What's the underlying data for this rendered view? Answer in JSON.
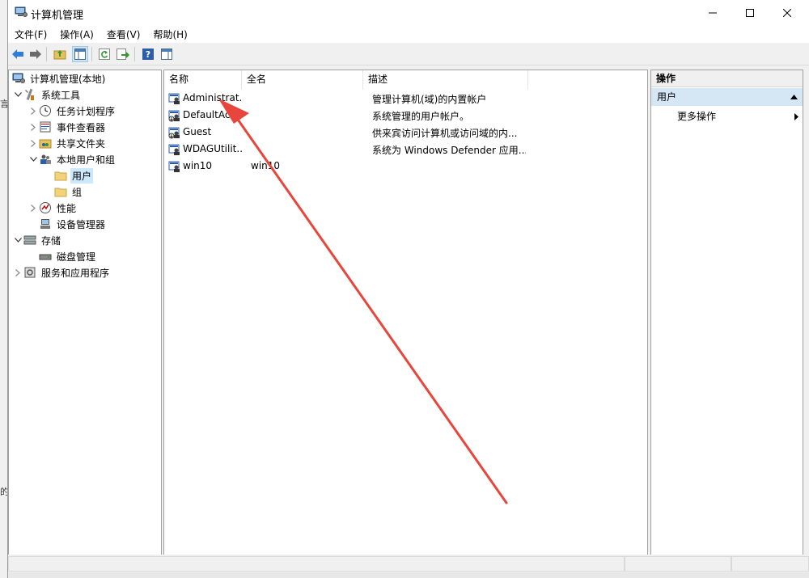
{
  "background_fragments": [
    "言",
    "的"
  ],
  "window": {
    "title": "计算机管理"
  },
  "menu": [
    {
      "label": "文件(F)"
    },
    {
      "label": "操作(A)"
    },
    {
      "label": "查看(V)"
    },
    {
      "label": "帮助(H)"
    }
  ],
  "tree": [
    {
      "label": "计算机管理(本地)",
      "icon": "computer-management-icon",
      "expander": "none"
    },
    {
      "label": "系统工具",
      "icon": "tools-icon",
      "expander": "expanded"
    },
    {
      "label": "任务计划程序",
      "icon": "clock-icon",
      "expander": "collapsed"
    },
    {
      "label": "事件查看器",
      "icon": "event-viewer-icon",
      "expander": "collapsed"
    },
    {
      "label": "共享文件夹",
      "icon": "shared-folder-icon",
      "expander": "collapsed"
    },
    {
      "label": "本地用户和组",
      "icon": "users-groups-icon",
      "expander": "expanded"
    },
    {
      "label": "用户",
      "icon": "folder-icon",
      "expander": "none",
      "selected": true
    },
    {
      "label": "组",
      "icon": "folder-icon",
      "expander": "none"
    },
    {
      "label": "性能",
      "icon": "performance-icon",
      "expander": "collapsed"
    },
    {
      "label": "设备管理器",
      "icon": "device-manager-icon",
      "expander": "none"
    },
    {
      "label": "存储",
      "icon": "storage-icon",
      "expander": "expanded"
    },
    {
      "label": "磁盘管理",
      "icon": "disk-icon",
      "expander": "none"
    },
    {
      "label": "服务和应用程序",
      "icon": "services-icon",
      "expander": "collapsed"
    }
  ],
  "list": {
    "columns": [
      "名称",
      "全名",
      "描述"
    ],
    "rows": [
      {
        "name": "Administrat...",
        "full_name": "",
        "description": "管理计算机(域)的内置帐户"
      },
      {
        "name": "DefaultAc...",
        "full_name": "",
        "description": "系统管理的用户帐户。"
      },
      {
        "name": "Guest",
        "full_name": "",
        "description": "供来宾访问计算机或访问域的内..."
      },
      {
        "name": "WDAGUtilit...",
        "full_name": "",
        "description": "系统为 Windows Defender 应用..."
      },
      {
        "name": "win10",
        "full_name": "win10",
        "description": ""
      }
    ]
  },
  "actions": {
    "header": "操作",
    "section": "用户",
    "items": [
      {
        "label": "更多操作"
      }
    ]
  },
  "colors": {
    "annotation_arrow": "#e8453c",
    "selection": "#cce8ff",
    "action_section": "#d5e6f5"
  }
}
